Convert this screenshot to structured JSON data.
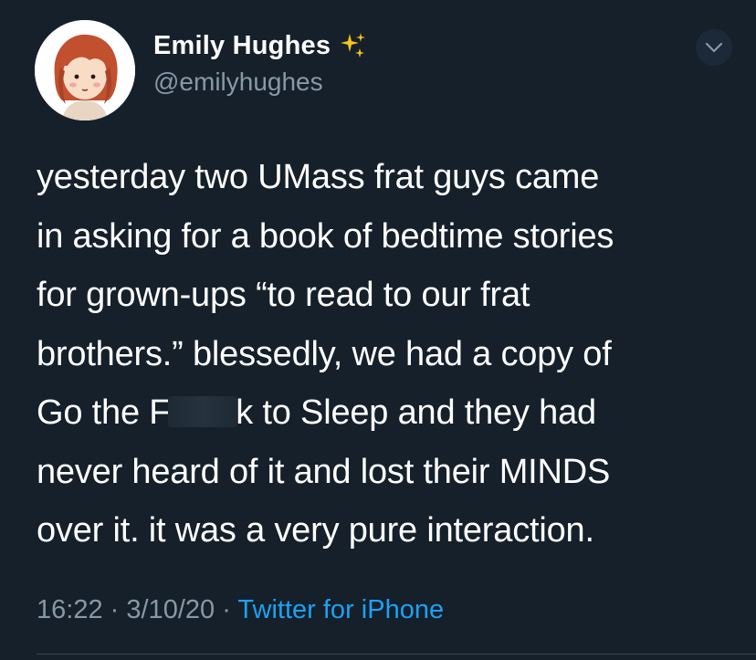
{
  "tweet": {
    "author": {
      "display_name": "Emily Hughes",
      "handle": "@emilyhughes",
      "name_emoji_icon": "sparkles-icon",
      "avatar_icon": "cartoon-redhead-avatar"
    },
    "body_lines": [
      "yesterday two UMass frat guys came",
      "in asking for a book of bedtime stories",
      "for grown-ups “to read to our frat",
      "brothers.” blessedly, we had a copy of",
      {
        "before": "Go the F",
        "censored": true,
        "after": "k to Sleep and they had"
      },
      "never heard of it and lost their MINDS",
      "over it. it was a very pure interaction."
    ],
    "time": "16:22",
    "date": "3/10/20",
    "separator": "·",
    "source": "Twitter for iPhone",
    "more_icon": "chevron-down-icon"
  },
  "colors": {
    "background": "#15202b",
    "text": "#ffffff",
    "secondary": "#8899a6",
    "link": "#1da1f2",
    "sparkle": "#f5c518"
  }
}
